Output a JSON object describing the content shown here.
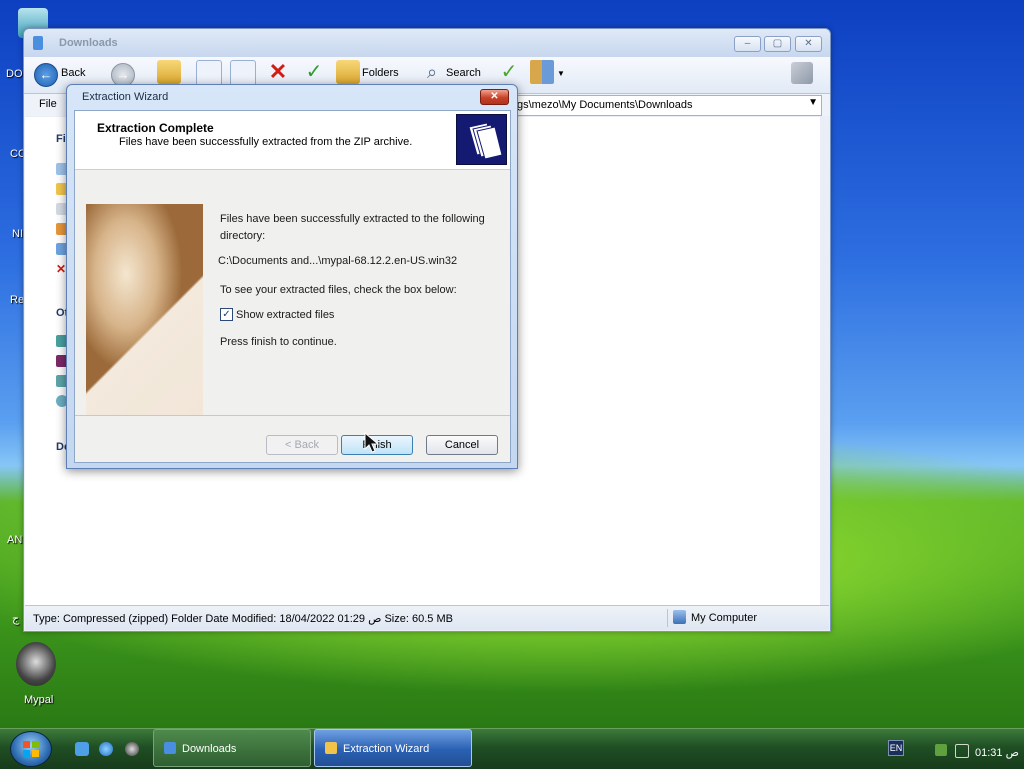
{
  "desktop": {
    "icons": [
      {
        "label": "DO"
      },
      {
        "label": "CO"
      },
      {
        "label": "NI"
      },
      {
        "label": "Re"
      },
      {
        "label": "AN"
      },
      {
        "label": "ج"
      },
      {
        "label": "Mypal"
      }
    ]
  },
  "explorer": {
    "title": "Downloads",
    "toolbar": {
      "back_label": "Back",
      "folders_label": "Folders",
      "search_label": "Search"
    },
    "menu": {
      "file_label": "File"
    },
    "address": "gs\\mezo\\My Documents\\Downloads",
    "leftpane": {
      "section1": "Fil",
      "section2": "Ot",
      "section3": "De"
    },
    "status": {
      "left": "Type: Compressed (zipped) Folder Date Modified: 18/04/2022 01:29 ص Size: 60.5 MB",
      "right": "My Computer"
    }
  },
  "wizard": {
    "title": "Extraction Wizard",
    "header_title": "Extraction Complete",
    "header_subtitle": "Files have been successfully extracted from the ZIP archive.",
    "line1": "Files have been successfully extracted to the following",
    "line2": "directory:",
    "path": "C:\\Documents and...\\mypal-68.12.2.en-US.win32",
    "instruction": "To see your extracted files, check the box below:",
    "checkbox_label": "Show extracted files",
    "checkbox_checked": true,
    "continue_text": "Press finish to continue.",
    "buttons": {
      "back": "< Back",
      "finish": "Finish",
      "cancel": "Cancel"
    }
  },
  "taskbar": {
    "tasks": [
      {
        "label": "Downloads",
        "active": false
      },
      {
        "label": "Extraction Wizard",
        "active": true
      }
    ],
    "tray": {
      "lang": "EN",
      "clock": "01:31 ص"
    }
  },
  "colors": {
    "taskbar": "#1f4f24",
    "active_task": "#2a60b3",
    "close_button": "#c7422a",
    "header_icon_bg": "#141a72"
  }
}
